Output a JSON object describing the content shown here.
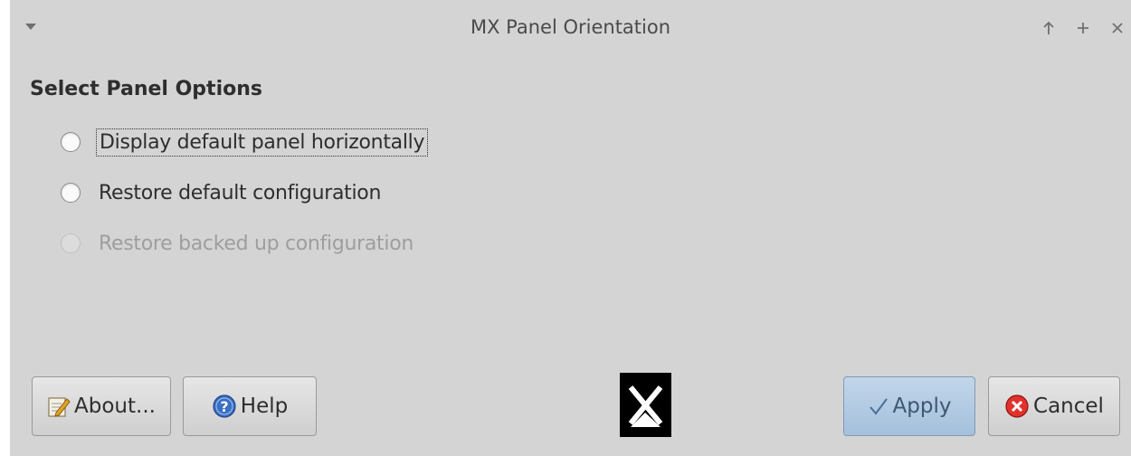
{
  "window": {
    "title": "MX Panel Orientation",
    "controls": [
      "arrow-up-icon",
      "plus-icon",
      "close-icon"
    ]
  },
  "section_title": "Select Panel Options",
  "options": [
    {
      "label": "Display default panel horizontally",
      "selected": false,
      "enabled": true,
      "focused": true
    },
    {
      "label": "Restore default configuration",
      "selected": false,
      "enabled": true,
      "focused": false
    },
    {
      "label": "Restore backed up configuration",
      "selected": false,
      "enabled": false,
      "focused": false
    }
  ],
  "buttons": {
    "about": "About...",
    "help": "Help",
    "apply": "Apply",
    "cancel": "Cancel"
  },
  "colors": {
    "window_bg": "#d4d4d4",
    "apply_bg": "#b3cbe3",
    "cancel_icon": "#e0322d",
    "help_icon": "#3a6fc4"
  }
}
